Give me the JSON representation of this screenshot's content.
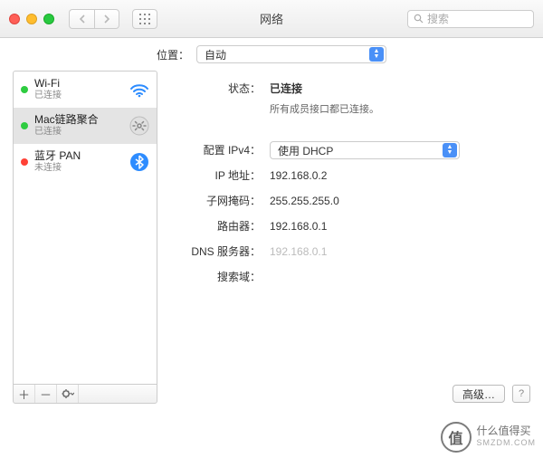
{
  "window": {
    "title": "网络"
  },
  "search": {
    "placeholder": "搜索"
  },
  "location": {
    "label": "位置：",
    "value": "自动"
  },
  "sidebar": {
    "items": [
      {
        "name": "Wi-Fi",
        "status": "已连接",
        "dot": "green"
      },
      {
        "name": "Mac链路聚合",
        "status": "已连接",
        "dot": "green"
      },
      {
        "name": "蓝牙 PAN",
        "status": "未连接",
        "dot": "red"
      }
    ]
  },
  "detail": {
    "status_label": "状态：",
    "status_value": "已连接",
    "status_sub": "所有成员接口都已连接。",
    "ipv4_label": "配置 IPv4：",
    "ipv4_value": "使用 DHCP",
    "ip_label": "IP 地址：",
    "ip_value": "192.168.0.2",
    "mask_label": "子网掩码：",
    "mask_value": "255.255.255.0",
    "router_label": "路由器：",
    "router_value": "192.168.0.1",
    "dns_label": "DNS 服务器：",
    "dns_value": "192.168.0.1",
    "search_label": "搜索域："
  },
  "footer": {
    "advanced": "高级…"
  },
  "watermark": {
    "line1": "什么值得买",
    "line2": "SMZDM.COM",
    "mark": "值"
  }
}
